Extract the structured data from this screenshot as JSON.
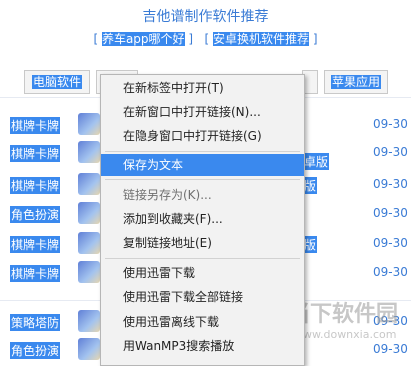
{
  "page": {
    "title": "吉他谱制作软件推荐",
    "links": [
      {
        "label": "养车app哪个好"
      },
      {
        "label": "安卓换机软件推荐"
      }
    ]
  },
  "tabs": [
    {
      "label": "电脑软件"
    },
    {
      "label": "苹果应用"
    }
  ],
  "rows": [
    {
      "category": "棋牌卡牌",
      "date": "09-30",
      "overlap_text": ""
    },
    {
      "category": "棋牌卡牌",
      "date": "09-30",
      "overlap_text": ""
    },
    {
      "category": "棋牌卡牌",
      "date": "09-30",
      "overlap_text": "卓版"
    },
    {
      "category": "棋牌卡牌",
      "date": "09-30",
      "overlap_text": "版"
    },
    {
      "category": "角色扮演",
      "date": "09-30",
      "overlap_text": ""
    },
    {
      "category": "棋牌卡牌",
      "date": "09-30",
      "overlap_text": "版"
    },
    {
      "category": "棋牌卡牌",
      "date": "09-30",
      "overlap_text": ""
    },
    {
      "category": "策略塔防",
      "date": "09-30",
      "overlap_text": ""
    },
    {
      "category": "角色扮演",
      "date": "09-30",
      "overlap_text": ""
    }
  ],
  "context_menu": {
    "items": [
      {
        "label": "在新标签中打开(T)",
        "state": "normal"
      },
      {
        "label": "在新窗口中打开链接(N)...",
        "state": "normal"
      },
      {
        "label": "在隐身窗口中打开链接(G)",
        "state": "normal"
      },
      {
        "label": "保存为文本",
        "state": "highlighted"
      },
      {
        "label": "链接另存为(K)...",
        "state": "disabled"
      },
      {
        "label": "添加到收藏夹(F)...",
        "state": "normal"
      },
      {
        "label": "复制链接地址(E)",
        "state": "normal"
      },
      {
        "label": "使用迅雷下载",
        "state": "normal"
      },
      {
        "label": "使用迅雷下载全部链接",
        "state": "normal"
      },
      {
        "label": "使用迅雷离线下载",
        "state": "normal"
      },
      {
        "label": "用WanMP3搜索播放",
        "state": "normal"
      }
    ]
  },
  "watermark": {
    "name": "当下软件园",
    "url": "www.downxia.com"
  },
  "colors": {
    "accent": "#3a89ee",
    "link": "#3a7bd5",
    "menu_bg": "#f2f2f2"
  }
}
